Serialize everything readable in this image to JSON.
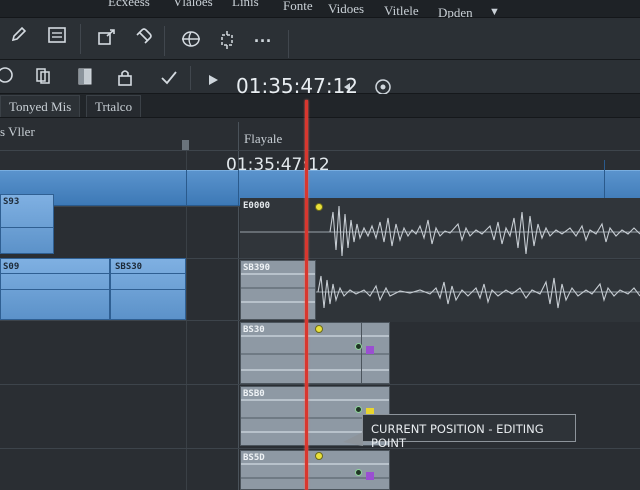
{
  "menubar": {
    "items": [
      "Ecxeess",
      "Vlaloes",
      "Linis",
      "Fonte",
      "Vidoes",
      "Vitlele",
      "Dpden"
    ]
  },
  "toolbar": {
    "icons_row1": [
      "pencil-icon",
      "list-icon",
      "export-icon",
      "link-icon",
      "globe-icon",
      "crop-icon",
      "more-icon"
    ],
    "icons_row2": [
      "circle-icon",
      "copy-icon",
      "clipboard-icon",
      "lock-icon",
      "check-icon",
      "play-icon"
    ],
    "timecode": "01:35:47:12",
    "nav_icons": [
      "prev-icon",
      "target-icon"
    ]
  },
  "tabs": [
    {
      "label": "Tonyed Mis"
    },
    {
      "label": "Trtalco"
    }
  ],
  "tracks": {
    "left_header": "s Vller",
    "right_header": "Flayale",
    "ruler_timecode": "01:35:47:12",
    "video_clips": [
      {
        "label": "S93"
      },
      {
        "label": "S09"
      },
      {
        "label": "SBS30"
      }
    ],
    "audio_clips": [
      {
        "label": "E0000"
      },
      {
        "label": "SB390"
      }
    ],
    "gray_clips": [
      {
        "label": "BS30"
      },
      {
        "label": "BSB0"
      },
      {
        "label": "BS5D"
      }
    ]
  },
  "tooltip": {
    "text": "CURRENT POSITION - EDITING POINT"
  },
  "colors": {
    "playhead": "#d9372f",
    "clip_blue": "#5c92c9",
    "marker_yellow": "#e9e03a",
    "marker_purple": "#9a4fd1"
  }
}
